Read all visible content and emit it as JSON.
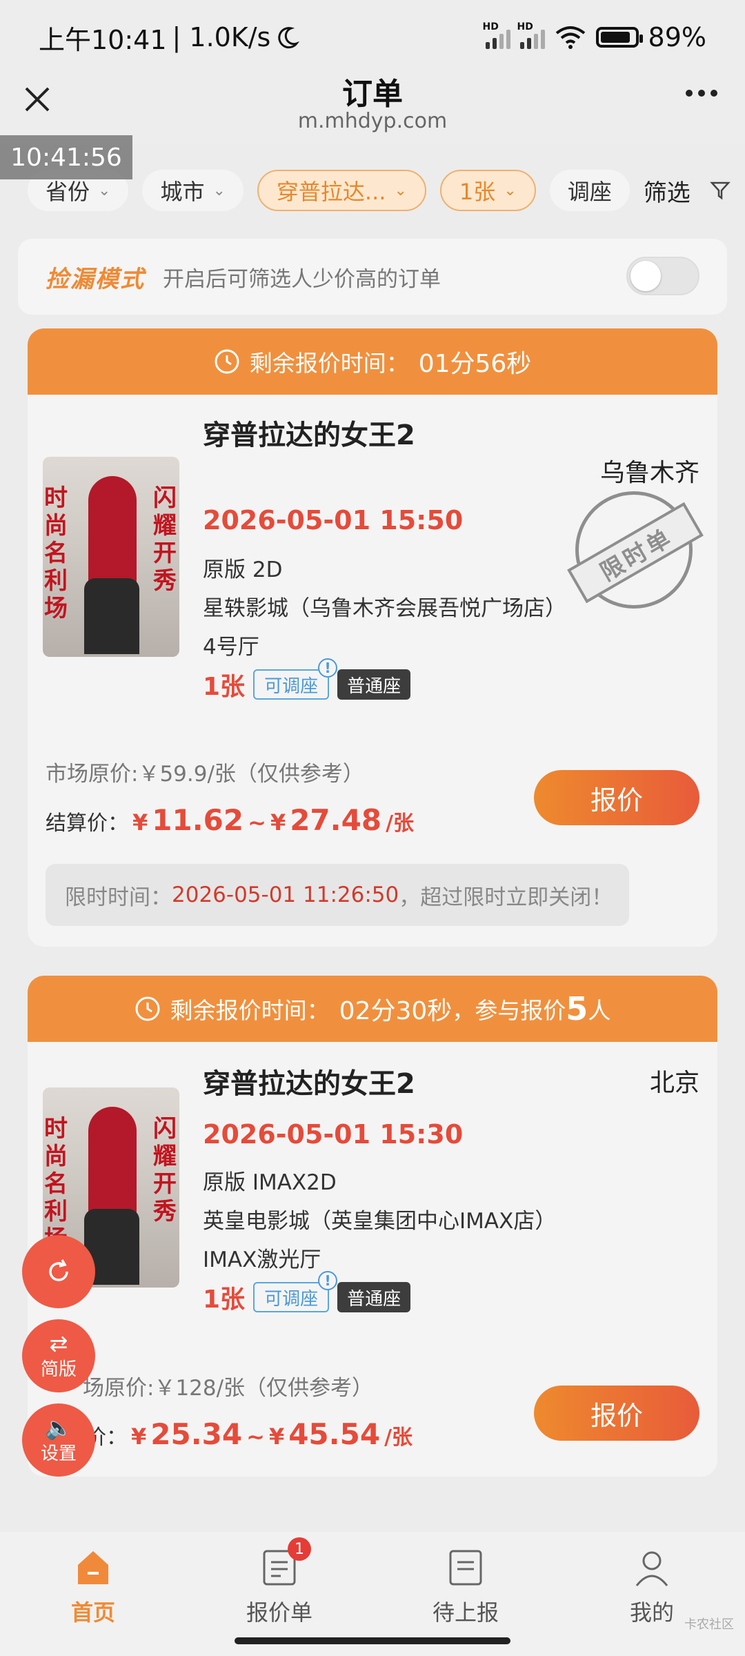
{
  "status_bar": {
    "time": "上午10:41",
    "net_speed": "| 1.0K/s",
    "battery": "89%"
  },
  "title_bar": {
    "title": "订单",
    "url": "m.mhdyp.com"
  },
  "clock_overlay": "10:41:56",
  "filters": {
    "province": "省份",
    "city": "城市",
    "movie": "穿普拉达...",
    "count": "1张",
    "adjust": "调座",
    "filter": "筛选"
  },
  "mode": {
    "title": "捡漏模式",
    "desc": "开启后可筛选人少价高的订单",
    "enabled": false
  },
  "orders": [
    {
      "head_label": "剩余报价时间：",
      "head_time": "01分56秒",
      "title": "穿普拉达的女王2",
      "city": "乌鲁木齐",
      "stamp": "限时单",
      "datetime": "2026-05-01 15:50",
      "version": "原版 2D",
      "cinema": "星轶影城（乌鲁木齐会展吾悦广场店）",
      "hall": "4号厅",
      "tickets": "1张",
      "tag_adjustable": "可调座",
      "tag_seat": "普通座",
      "market_price": "市场原价:￥59.9/张（仅供参考）",
      "settle_label": "结算价：",
      "settle_min": "11.62",
      "settle_max": "27.48",
      "settle_unit": "/张",
      "quote_button": "报价",
      "limit_label": "限时时间：",
      "limit_time": "2026-05-01 11:26:50",
      "limit_suffix": "，超过限时立即关闭！"
    },
    {
      "head_label": "剩余报价时间：",
      "head_time": "02分30秒",
      "head_join_prefix": "，参与报价",
      "head_join_count": "5",
      "head_join_suffix": "人",
      "title": "穿普拉达的女王2",
      "city": "北京",
      "datetime": "2026-05-01 15:30",
      "version": "原版 IMAX2D",
      "cinema": "英皇电影城（英皇集团中心IMAX店）",
      "hall": "IMAX激光厅",
      "tickets": "1张",
      "tag_adjustable": "可调座",
      "tag_seat": "普通座",
      "market_price": "场原价:￥128/张（仅供参考）",
      "settle_label": "价：",
      "settle_min": "25.34",
      "settle_max": "45.54",
      "settle_unit": "/张",
      "quote_button": "报价"
    }
  ],
  "poster_text": {
    "left": "时尚名利场",
    "right": "闪耀开秀"
  },
  "fabs": {
    "simple": "简版",
    "settings": "设置"
  },
  "bottom_nav": [
    {
      "label": "首页",
      "active": true
    },
    {
      "label": "报价单",
      "badge": "1"
    },
    {
      "label": "待上报"
    },
    {
      "label": "我的"
    }
  ],
  "watermark": "卡农社区",
  "colors": {
    "accent_orange": "#f0903e",
    "price_red": "#e54b3a",
    "tag_blue": "#4d99d6"
  }
}
